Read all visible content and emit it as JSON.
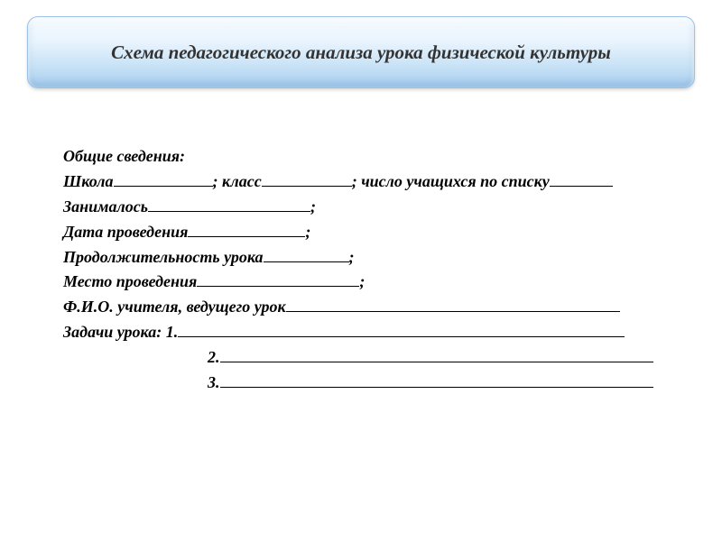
{
  "title": "Схема педагогического анализа урока физической культуры",
  "form": {
    "section_heading": "Общие сведения:",
    "school_label": "Школа",
    "class_label": "; класс",
    "students_label": "; число учащихся по списку",
    "engaged_label": "Занималось",
    "date_label": "Дата проведения",
    "duration_label": "Продолжительность урока",
    "place_label": "Место проведения",
    "teacher_label": "Ф.И.О. учителя, ведущего урок",
    "tasks_label": "Задачи урока: 1.",
    "task2_label": "2.",
    "task3_label": "3.",
    "semicolon": ";"
  }
}
